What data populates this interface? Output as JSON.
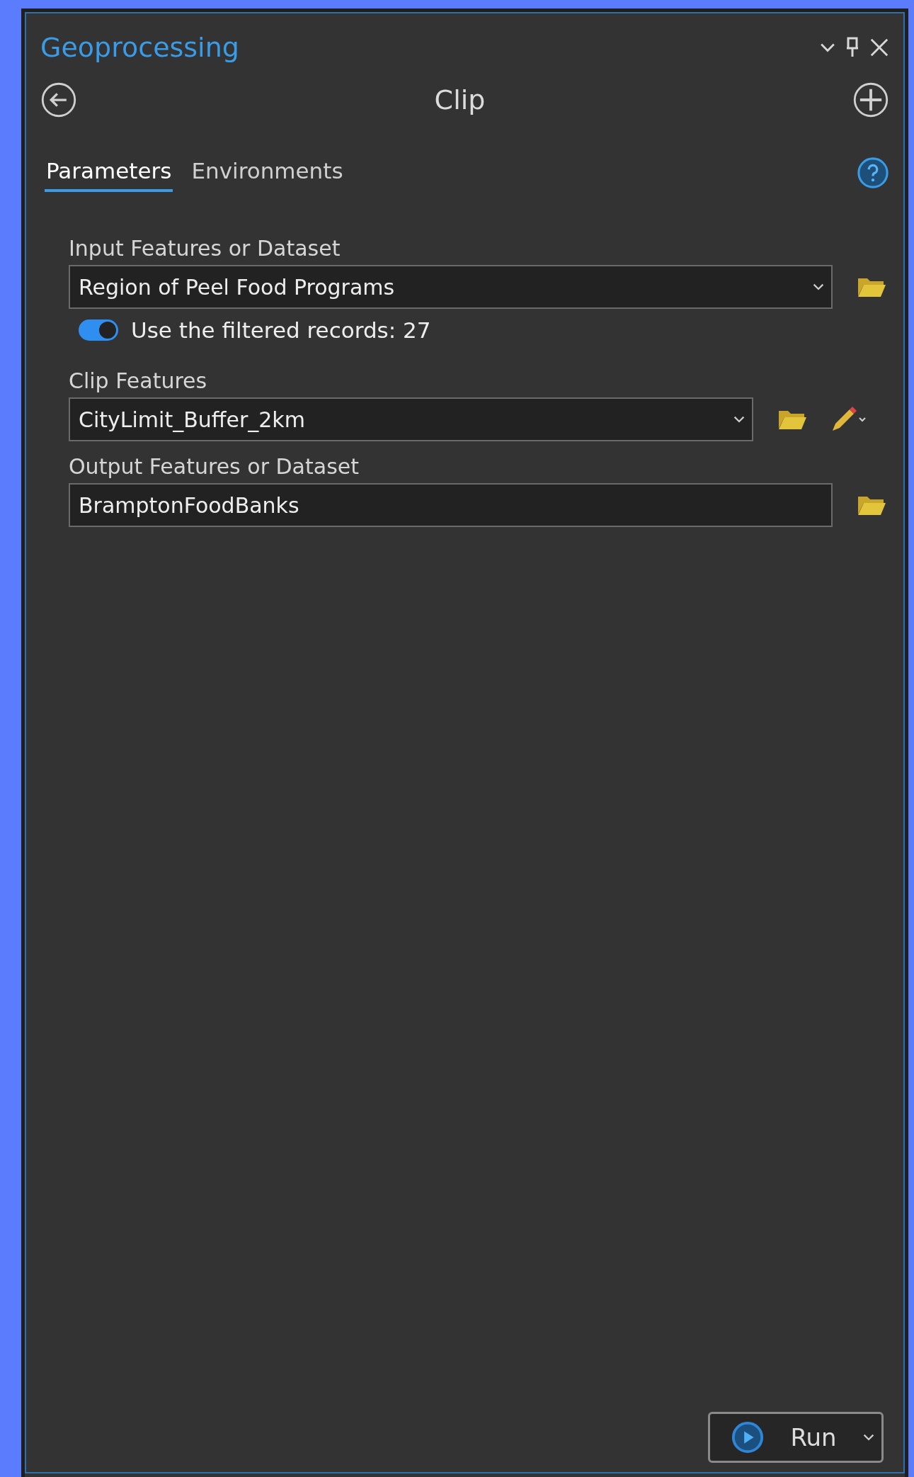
{
  "pane": {
    "title": "Geoprocessing"
  },
  "tool": {
    "title": "Clip"
  },
  "tabs": [
    {
      "label": "Parameters",
      "selected": true
    },
    {
      "label": "Environments",
      "selected": false
    }
  ],
  "parameters": [
    {
      "label": "Input Features or Dataset",
      "kind": "dropdown",
      "value": "Region of Peel Food Programs",
      "toggle": {
        "label": "Use the filtered records: 27",
        "on": true
      }
    },
    {
      "label": "Clip Features",
      "kind": "dropdown-sketch",
      "value": "CityLimit_Buffer_2km"
    },
    {
      "label": "Output Features or Dataset",
      "kind": "text",
      "value": "BramptonFoodBanks"
    }
  ],
  "run_button": {
    "label": "Run"
  }
}
